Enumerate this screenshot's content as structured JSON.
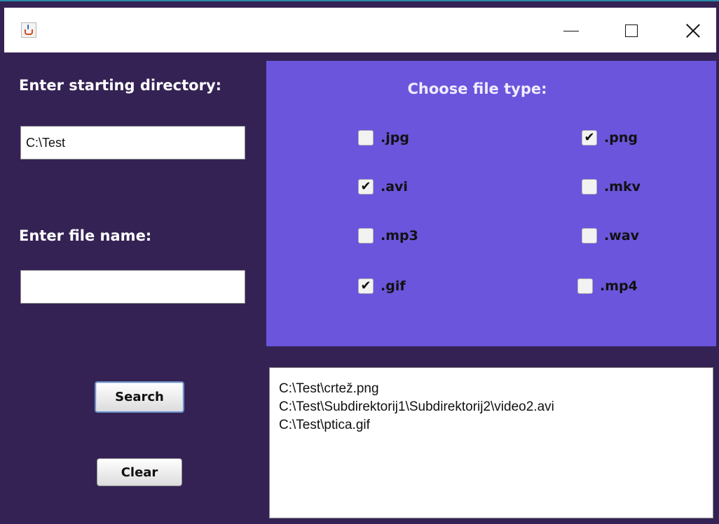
{
  "window": {
    "controls": {
      "minimize_icon": "minimize-icon",
      "maximize_icon": "maximize-icon",
      "close_icon": "close-icon"
    },
    "colors": {
      "frame": "#342254",
      "panel": "#6b55dc",
      "titlebar": "#ffffff"
    }
  },
  "left": {
    "directory_label": "Enter starting directory:",
    "directory_value": "C:\\Test",
    "filename_label": "Enter file name:",
    "filename_value": "",
    "search_label": "Search",
    "clear_label": "Clear"
  },
  "panel": {
    "title": "Choose file type:",
    "checkboxes": [
      {
        "label": ".jpg",
        "checked": false
      },
      {
        "label": ".png",
        "checked": true
      },
      {
        "label": ".avi",
        "checked": true
      },
      {
        "label": ".mkv",
        "checked": false
      },
      {
        "label": ".mp3",
        "checked": false
      },
      {
        "label": ".wav",
        "checked": false
      },
      {
        "label": ".gif",
        "checked": true
      },
      {
        "label": ".mp4",
        "checked": false
      }
    ]
  },
  "results": {
    "lines": [
      "C:\\Test\\crtež.png",
      "C:\\Test\\Subdirektorij1\\Subdirektorij2\\video2.avi",
      "C:\\Test\\ptica.gif"
    ]
  }
}
